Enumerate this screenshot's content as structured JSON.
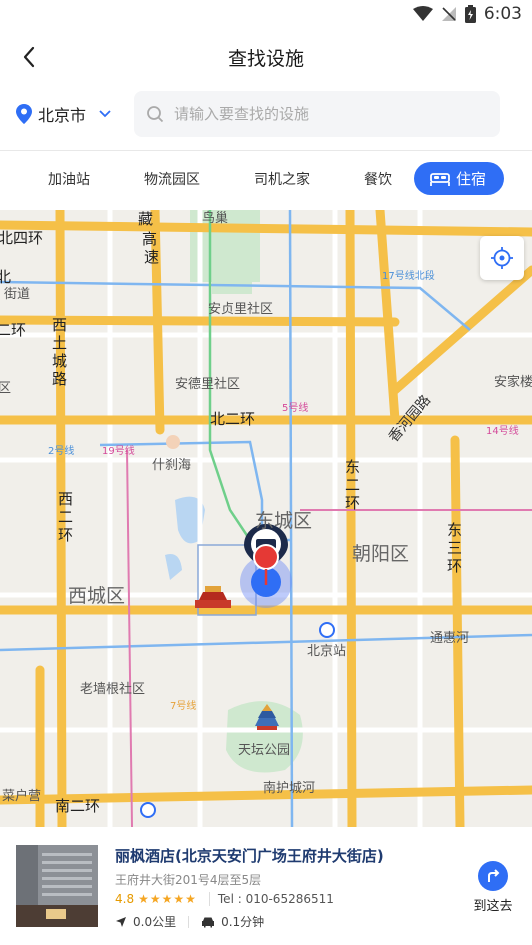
{
  "status_bar": {
    "time": "6:03"
  },
  "header": {
    "title": "查找设施"
  },
  "search": {
    "city": "北京市",
    "placeholder": "请输入要查找的设施"
  },
  "tabs": [
    {
      "label": "加油站"
    },
    {
      "label": "物流园区"
    },
    {
      "label": "司机之家"
    },
    {
      "label": "餐饮"
    },
    {
      "label": "住宿",
      "active": true
    }
  ],
  "map": {
    "labels": {
      "road_beisihuan": "北四环",
      "road_cang_gao": "藏",
      "road_gao": "高",
      "road_su": "速",
      "niaochao": "鸟巢",
      "jiedao": "街道",
      "north_left": "北",
      "erhuan_left": "二环",
      "xitucheng1": "西",
      "xitucheng2": "土",
      "xitucheng3": "城",
      "xitucheng4": "路",
      "anzhenli": "安贞里社区",
      "andeli": "安德里社区",
      "line17": "17号线北段",
      "line5": "5号线",
      "line2": "2号线",
      "line19": "19号线",
      "line14": "14号线",
      "line7": "7号线",
      "xiangheyuan": "香河园路",
      "anjiarou": "安家楼",
      "beierhuan": "北二环",
      "shichahai": "什刹海",
      "dongerhuan1": "东",
      "dongerhuan2": "二",
      "dongerhuan3": "环",
      "dongsanhuan1": "东",
      "dongsanhuan2": "三",
      "dongsanhuan3": "环",
      "xierhuan1": "西",
      "xierhuan2": "二",
      "xierhuan3": "环",
      "dongcheng": "东城区",
      "chaoyang": "朝阳区",
      "xicheng": "西城区",
      "beijingzhan": "北京站",
      "tonghuihe": "通惠河",
      "laoqianggen": "老墙根社区",
      "tiantan": "天坛公园",
      "nanhucheng": "南护城河",
      "caihuying": "菜户营",
      "nanerhuan": "南二环",
      "qu_left": "区",
      "ji_huan": "环"
    }
  },
  "poi": {
    "name": "丽枫酒店(北京天安门广场王府井大街店)",
    "address": "王府井大街201号4层至5层",
    "rating": "4.8",
    "stars_fraction": 0.9,
    "tel": "Tel : 010-65286511",
    "distance": "0.0公里",
    "duration": "0.1分钟",
    "goto_label": "到这去"
  },
  "colors": {
    "accent": "#2f6ef5",
    "ring_road": "#f5c048",
    "subway": "#7fb6f0"
  }
}
